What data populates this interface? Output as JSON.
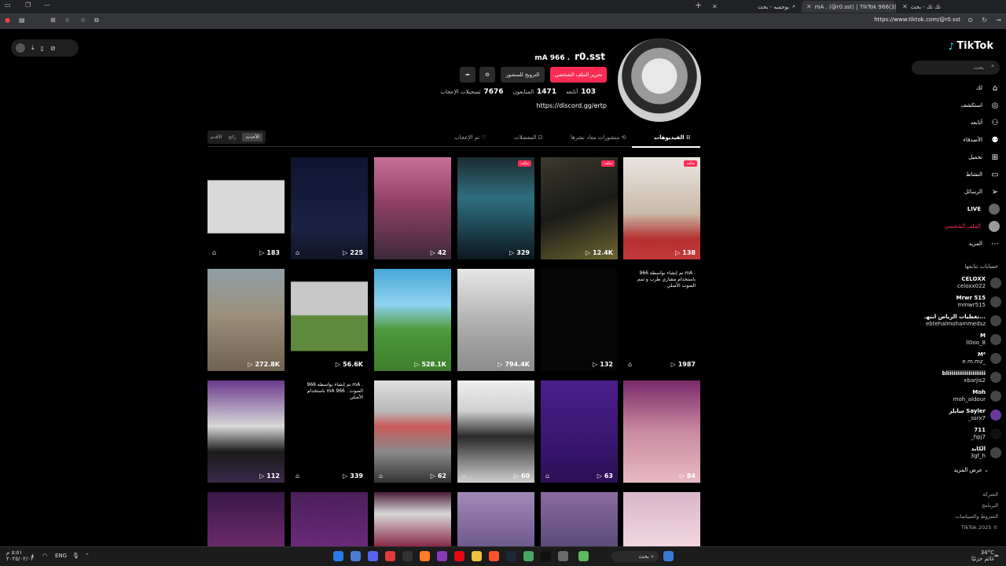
{
  "browser": {
    "tabs": [
      {
        "title": "تك تك - بحث"
      },
      {
        "title": "mA . (@r0.sst) | TikTok 966(3)"
      },
      {
        "title": "بوجمبه - بحث"
      }
    ],
    "new_tab": "+",
    "url": "https://www.tiktok.com/@r0.sst"
  },
  "float_toolbar": {
    "icons": [
      "download-icon",
      "phone-icon",
      "block-icon"
    ]
  },
  "sidebar": {
    "logo": "TikTok",
    "search_placeholder": "بحث",
    "nav": [
      {
        "label": "لك",
        "icon": "home-icon"
      },
      {
        "label": "استكشف",
        "icon": "compass-icon"
      },
      {
        "label": "أتابعه",
        "icon": "following-icon"
      },
      {
        "label": "الأصدقاء",
        "icon": "friends-icon"
      },
      {
        "label": "تحميل",
        "icon": "upload-icon"
      },
      {
        "label": "النشاط",
        "icon": "activity-icon"
      },
      {
        "label": "الرسائل",
        "icon": "messages-icon"
      },
      {
        "label": "LIVE",
        "icon": "live-icon"
      },
      {
        "label": "الملف الشخصي",
        "icon": "profile-icon"
      },
      {
        "label": "المزيد",
        "icon": "more-icon"
      }
    ],
    "following_heading": "حسابات تتابعها",
    "accounts": [
      {
        "name": "CELOXX",
        "user": "celoxx022"
      },
      {
        "name": "Mrwr 515",
        "user": "mmwr515"
      },
      {
        "name": "تغطيات الرياض ابتهـ...",
        "user": "ebtehalmohammedsz"
      },
      {
        "name": "M",
        "user": "ll0oo_8"
      },
      {
        "name": "M⁴",
        "user": "e.m.mz_"
      },
      {
        "name": "bliiiiiiiiiiiiiiiiiiii",
        "user": "xbarjis2"
      },
      {
        "name": "Moh",
        "user": "moh_aldour"
      },
      {
        "name": "سايلر Sayler",
        "user": "_ssrx7"
      },
      {
        "name": "711",
        "user": "_hpj7"
      },
      {
        "name": "الكايد",
        "user": "3gf_h"
      }
    ],
    "see_more": "عرض المزيد",
    "footer": [
      "الشركة",
      "البرنامج",
      "الشروط والسياسات",
      "TikTok 2025 ©"
    ]
  },
  "profile": {
    "username": "r0.sst",
    "nickname": "mA 966 .",
    "edit_button": "تحرير الملف الشخصي",
    "promote_button": "الترويج للمنشور",
    "stats": [
      {
        "value": "103",
        "label": "أتابعه"
      },
      {
        "value": "1471",
        "label": "المتابعون"
      },
      {
        "value": "7676",
        "label": "تسجيلات الإعجاب"
      }
    ],
    "link": "https://discord.gg/ertp"
  },
  "content_tabs": [
    {
      "label": "الفيديوهات",
      "active": true
    },
    {
      "label": "منشورات معاد نشرها",
      "active": false
    },
    {
      "label": "المفضلات",
      "active": false
    },
    {
      "label": "تم الإعجاب",
      "active": false
    }
  ],
  "sort": {
    "options": [
      "الأحدث",
      "رائج",
      "الأقدم"
    ],
    "selected": "الأحدث"
  },
  "videos": [
    {
      "count": "138",
      "pinned": "مثبّت",
      "private": false
    },
    {
      "count": "12.4K",
      "pinned": "مثبّت",
      "private": false
    },
    {
      "count": "329",
      "pinned": "مثبّت",
      "private": false
    },
    {
      "count": "42",
      "pinned": "",
      "private": false
    },
    {
      "count": "225",
      "pinned": "",
      "private": true
    },
    {
      "count": "183",
      "pinned": "",
      "private": true
    },
    {
      "count": "1987",
      "pinned": "",
      "private": true,
      "caption": "تم إنشاء بواسطة 966 mA . باستخدام مشاري طرب و تمم الصوت الأصلي"
    },
    {
      "count": "132",
      "pinned": "",
      "private": false
    },
    {
      "count": "794.4K",
      "pinned": "",
      "private": false
    },
    {
      "count": "528.1K",
      "pinned": "",
      "private": false
    },
    {
      "count": "56.6K",
      "pinned": "",
      "private": false
    },
    {
      "count": "272.8K",
      "pinned": "",
      "private": false
    },
    {
      "count": "84",
      "pinned": "",
      "private": false
    },
    {
      "count": "63",
      "pinned": "",
      "private": true
    },
    {
      "count": "60",
      "pinned": "",
      "private": true
    },
    {
      "count": "62",
      "pinned": "",
      "private": true
    },
    {
      "count": "339",
      "pinned": "",
      "private": true,
      "caption": "تم إنشاء بواسطة 966 mA . باستخدام mA 966 . الصوت الأصلي"
    },
    {
      "count": "112",
      "pinned": "",
      "private": false
    }
  ],
  "taskbar": {
    "time": "٥:٥١ م",
    "date": "٢٠٢٥/٠٢/٠٣",
    "lang": "ENG",
    "weather_temp": "34°C",
    "weather_desc": "غائم جزئيًا",
    "search": "بحث"
  }
}
